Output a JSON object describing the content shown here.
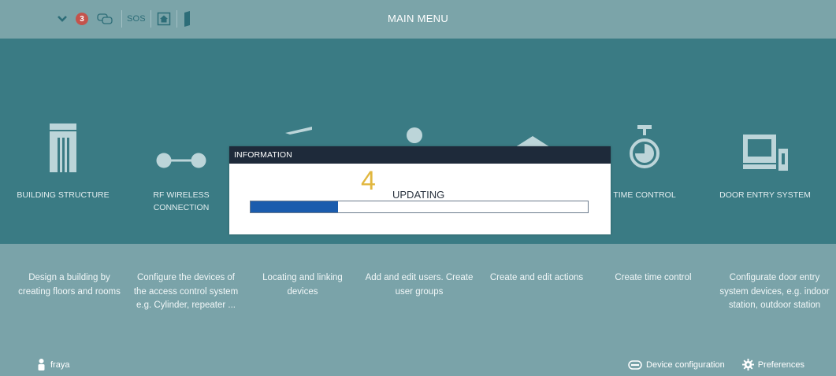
{
  "header": {
    "title": "MAIN MENU",
    "notification_count": "3",
    "sos_label": "SOS"
  },
  "menu": {
    "tiles": [
      {
        "label": "BUILDING STRUCTURE",
        "description": "Design a building by creating floors and rooms",
        "icon": "building-icon"
      },
      {
        "label": "RF WIRELESS CONNECTION",
        "description": "Configure the devices of the access control system e.g. Cylinder, repeater ...",
        "icon": "link-icon"
      },
      {
        "label": "",
        "description": "Locating and linking devices",
        "icon": "devices-icon"
      },
      {
        "label": "",
        "description": "Add and edit users. Create user groups",
        "icon": "user-icon"
      },
      {
        "label": "",
        "description": "Create and edit actions",
        "icon": "action-icon"
      },
      {
        "label": "TIME CONTROL",
        "description": "Create time control",
        "icon": "stopwatch-icon"
      },
      {
        "label": "DOOR ENTRY SYSTEM",
        "description": "Configurate door entry system devices, e.g. indoor station, outdoor station",
        "icon": "door-entry-icon"
      }
    ]
  },
  "dialog": {
    "title": "INFORMATION",
    "countdown": "4",
    "status": "UPDATING",
    "progress": 0.26
  },
  "footer": {
    "user": "fraya",
    "device_config_label": "Device configuration",
    "preferences_label": "Preferences"
  },
  "colors": {
    "band": "#3a7b84",
    "background": "#7aa3a9",
    "dialog_header": "#1e2a3a",
    "progress_fill": "#1b5cad",
    "countdown": "#e1b73f",
    "badge": "#c4534c"
  }
}
